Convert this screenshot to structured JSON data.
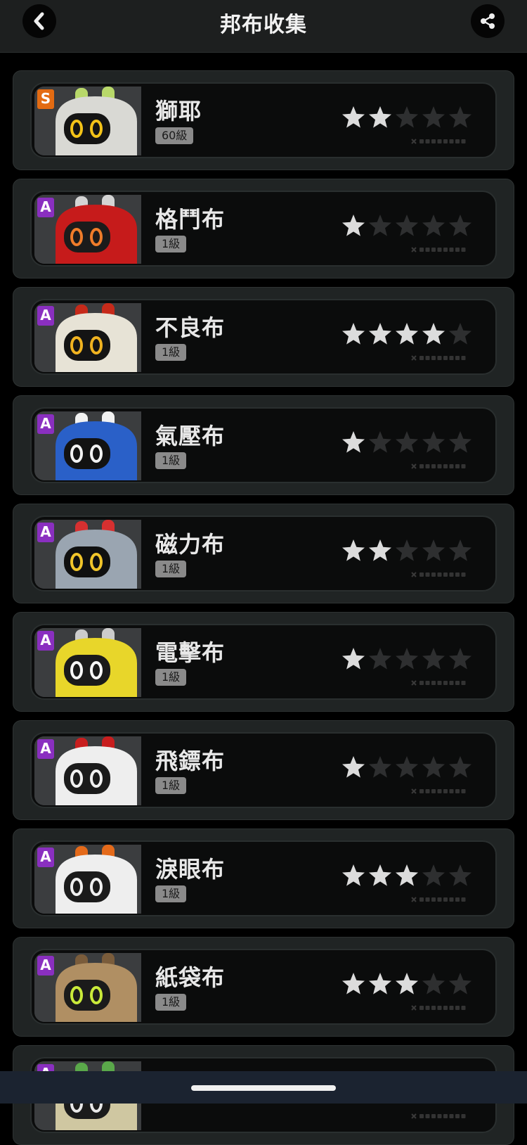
{
  "header": {
    "title": "邦布收集",
    "back_icon": "chevron-left-icon",
    "share_icon": "share-icon"
  },
  "colors": {
    "star_filled": "#dcdcdc",
    "star_empty": "#2e2f30",
    "rank_s": "#e36b12",
    "rank_a": "#8a2fc0"
  },
  "bangboos": [
    {
      "name": "獅耶",
      "level": "60級",
      "rank": "S",
      "stars": 2,
      "max_stars": 5,
      "portrait": "shiye-portrait"
    },
    {
      "name": "格鬥布",
      "level": "1級",
      "rank": "A",
      "stars": 1,
      "max_stars": 5,
      "portrait": "gedoubu-portrait"
    },
    {
      "name": "不良布",
      "level": "1級",
      "rank": "A",
      "stars": 4,
      "max_stars": 5,
      "portrait": "buliangbu-portrait"
    },
    {
      "name": "氣壓布",
      "level": "1級",
      "rank": "A",
      "stars": 1,
      "max_stars": 5,
      "portrait": "qiyabu-portrait"
    },
    {
      "name": "磁力布",
      "level": "1級",
      "rank": "A",
      "stars": 2,
      "max_stars": 5,
      "portrait": "cilibu-portrait"
    },
    {
      "name": "電擊布",
      "level": "1級",
      "rank": "A",
      "stars": 1,
      "max_stars": 5,
      "portrait": "dianjibu-portrait"
    },
    {
      "name": "飛鏢布",
      "level": "1級",
      "rank": "A",
      "stars": 1,
      "max_stars": 5,
      "portrait": "feibiaobu-portrait"
    },
    {
      "name": "淚眼布",
      "level": "1級",
      "rank": "A",
      "stars": 3,
      "max_stars": 5,
      "portrait": "leiyanbu-portrait"
    },
    {
      "name": "紙袋布",
      "level": "1級",
      "rank": "A",
      "stars": 3,
      "max_stars": 5,
      "portrait": "zhidaibu-portrait"
    },
    {
      "name": "",
      "level": "",
      "rank": "A",
      "stars": 0,
      "max_stars": 5,
      "portrait": "partial-portrait"
    }
  ]
}
